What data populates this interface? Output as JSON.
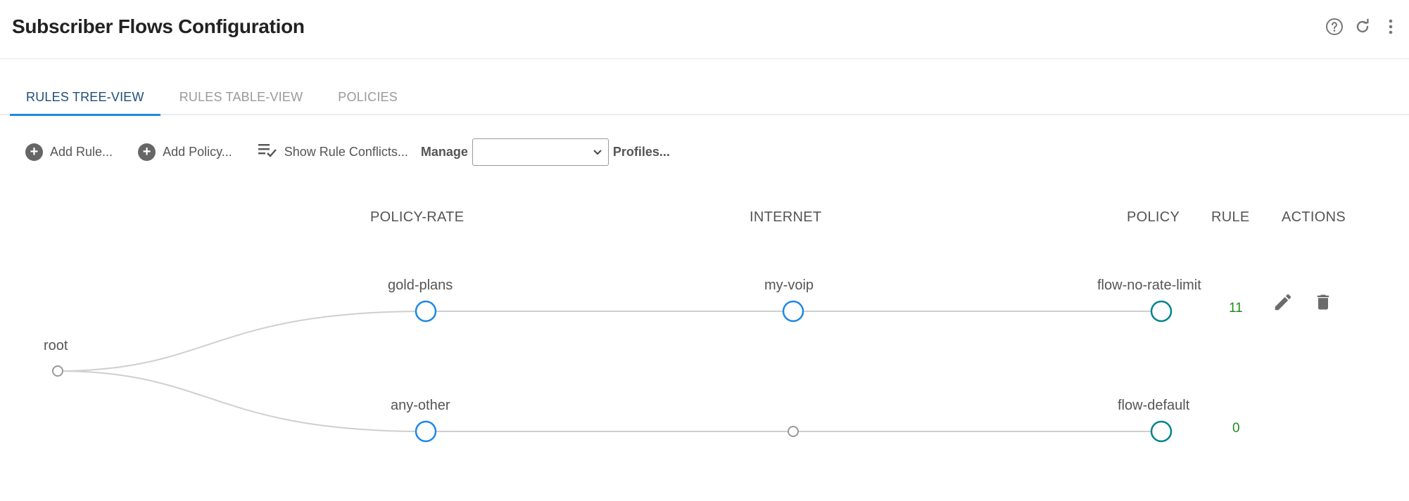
{
  "header": {
    "title": "Subscriber Flows Configuration",
    "icons": [
      "help-icon",
      "refresh-icon",
      "more-vertical-icon"
    ]
  },
  "tabs": [
    {
      "label": "RULES TREE-VIEW",
      "active": true
    },
    {
      "label": "RULES TABLE-VIEW",
      "active": false
    },
    {
      "label": "POLICIES",
      "active": false
    }
  ],
  "toolbar": {
    "add_rule": "Add Rule...",
    "add_policy": "Add Policy...",
    "show_conflicts": "Show Rule Conflicts...",
    "manage_label": "Manage",
    "manage_select_value": "",
    "profiles_label": "Profiles..."
  },
  "columns": {
    "policy_rate": "POLICY-RATE",
    "internet": "INTERNET",
    "policy": "POLICY",
    "rule": "RULE",
    "actions": "ACTIONS"
  },
  "tree": {
    "root": "root",
    "rows": [
      {
        "policy_rate": "gold-plans",
        "internet": "my-voip",
        "policy": "flow-no-rate-limit",
        "rule_count": "11",
        "actions": [
          "edit-icon",
          "delete-icon"
        ]
      },
      {
        "policy_rate": "any-other",
        "internet": "",
        "policy": "flow-default",
        "rule_count": "0",
        "actions": []
      }
    ]
  },
  "colors": {
    "accent": "#1e88e5",
    "policy_node": "#00838f",
    "count_text": "#1f8a1f",
    "edge": "#cfcfcf"
  }
}
